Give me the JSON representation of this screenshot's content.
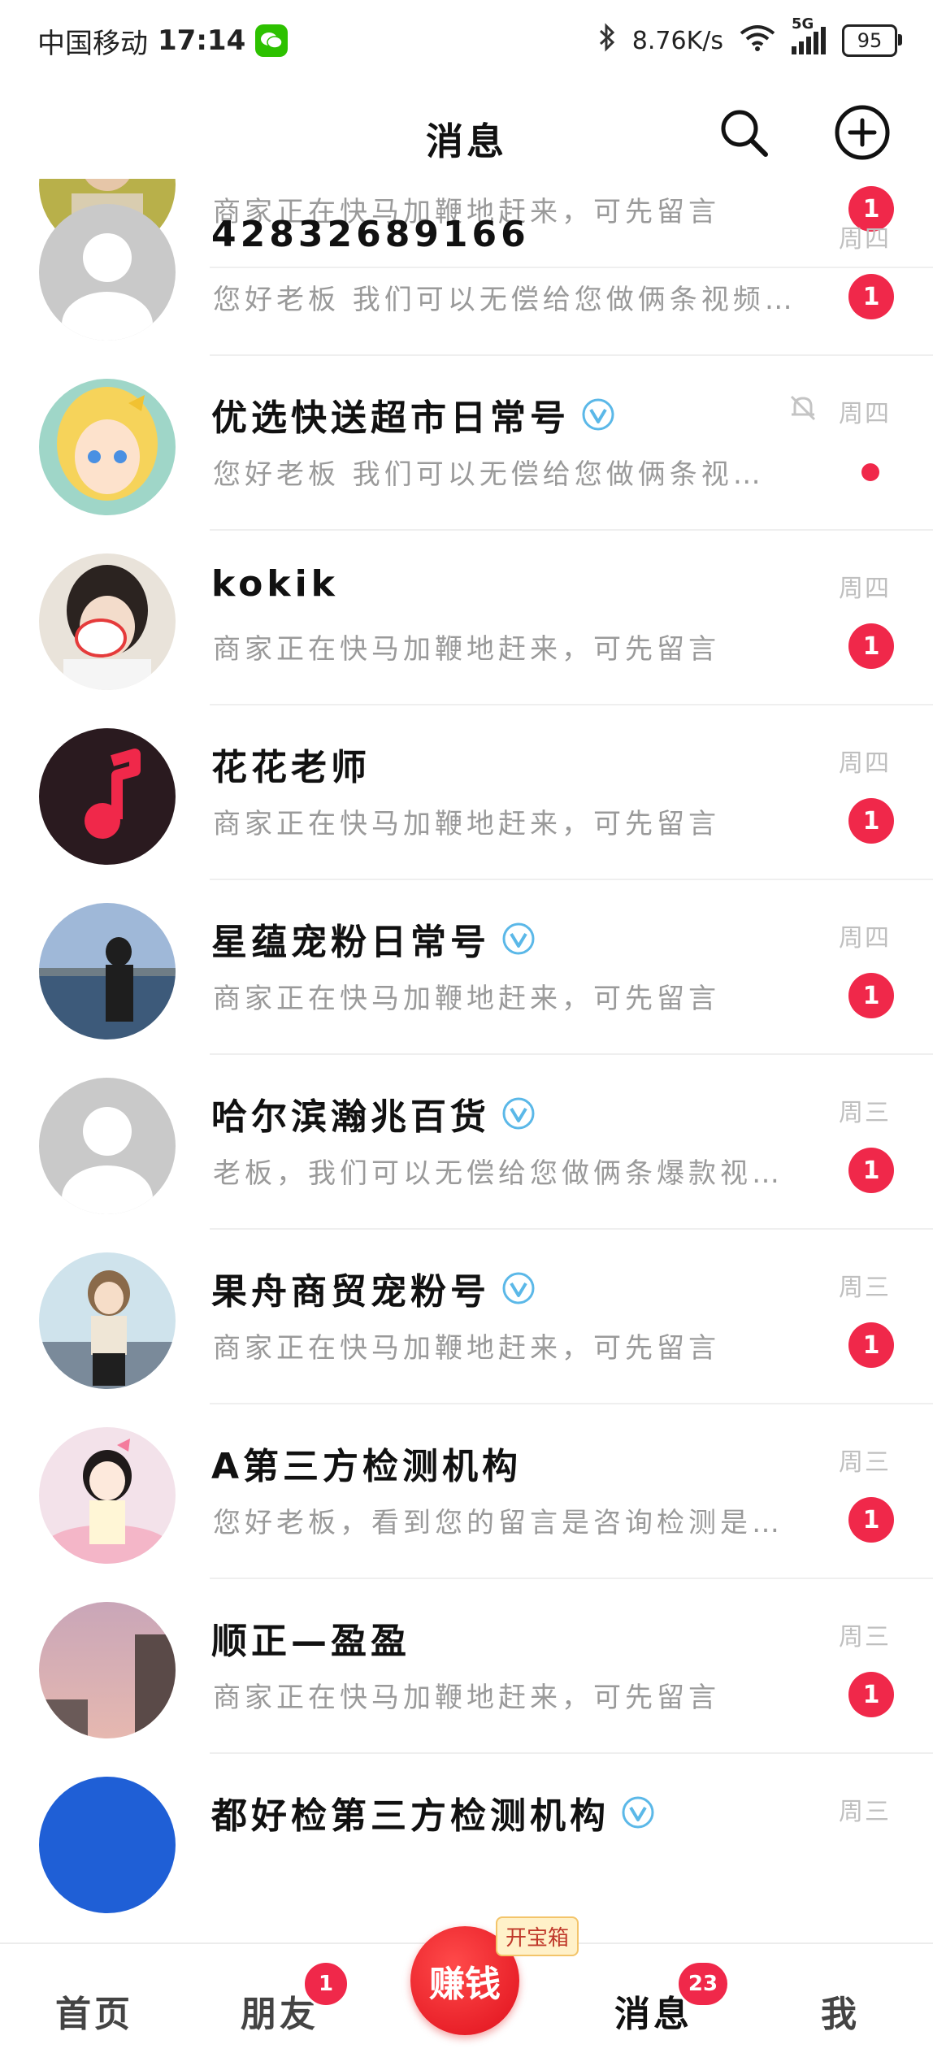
{
  "status_bar": {
    "carrier": "中国移动",
    "time": "17:14",
    "net_speed": "8.76K/s",
    "network": "5G",
    "battery": "95"
  },
  "header": {
    "title": "消息"
  },
  "conversations": [
    {
      "name": "",
      "verified": false,
      "time": "",
      "preview": "商家正在快马加鞭地赶来，可先留言",
      "unread": "1"
    },
    {
      "name": "42832689166",
      "verified": false,
      "time": "周四",
      "preview": "您好老板 我们可以无偿给您做俩条视频…",
      "unread": "1"
    },
    {
      "name": "优选快送超市日常号",
      "verified": true,
      "time": "周四",
      "muted": true,
      "preview": "您好老板 我们可以无偿给您做俩条视…",
      "unread": ""
    },
    {
      "name": "kokik",
      "verified": false,
      "time": "周四",
      "preview": "商家正在快马加鞭地赶来，可先留言",
      "unread": "1"
    },
    {
      "name": "花花老师",
      "verified": false,
      "time": "周四",
      "preview": "商家正在快马加鞭地赶来，可先留言",
      "unread": "1"
    },
    {
      "name": "星蕴宠粉日常号",
      "verified": true,
      "time": "周四",
      "preview": "商家正在快马加鞭地赶来，可先留言",
      "unread": "1"
    },
    {
      "name": "哈尔滨瀚兆百货",
      "verified": true,
      "time": "周三",
      "preview": "老板，我们可以无偿给您做俩条爆款视…",
      "unread": "1"
    },
    {
      "name": "果舟商贸宠粉号",
      "verified": true,
      "time": "周三",
      "preview": "商家正在快马加鞭地赶来，可先留言",
      "unread": "1"
    },
    {
      "name": "A第三方检测机构",
      "verified": false,
      "time": "周三",
      "preview": "您好老板，看到您的留言是咨询检测是…",
      "unread": "1"
    },
    {
      "name": "顺正—盈盈",
      "verified": false,
      "time": "周三",
      "preview": "商家正在快马加鞭地赶来，可先留言",
      "unread": "1"
    },
    {
      "name": "都好检第三方检测机构",
      "verified": true,
      "time": "周三",
      "preview": "",
      "unread": ""
    }
  ],
  "tabbar": {
    "home": "首页",
    "friends": "朋友",
    "friends_badge": "1",
    "earn": "赚钱",
    "earn_tag": "开宝箱",
    "messages": "消息",
    "messages_badge": "23",
    "me": "我"
  },
  "colors": {
    "accent": "#f0284a",
    "verified": "#5bb8e8"
  }
}
